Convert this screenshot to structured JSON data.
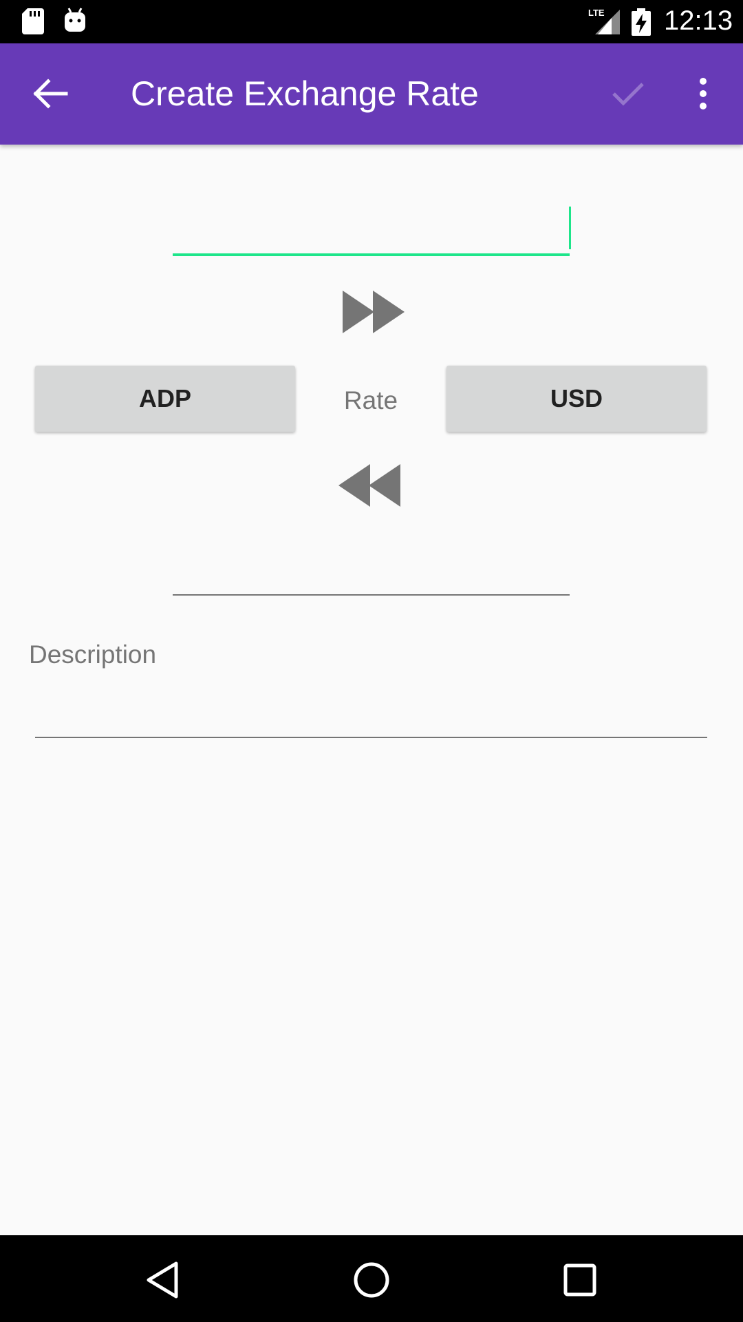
{
  "status_bar": {
    "time": "12:13",
    "icons": [
      "sd-card-icon",
      "android-icon",
      "lte-signal-icon",
      "battery-charging-icon"
    ]
  },
  "app_bar": {
    "title": "Create Exchange Rate",
    "icons": [
      "arrow-back-icon",
      "check-icon",
      "more-vert-icon"
    ]
  },
  "form": {
    "from_amount": "",
    "from_currency": "ADP",
    "rate_label": "Rate",
    "to_currency": "USD",
    "to_amount": "",
    "description_label": "Description",
    "description_value": ""
  },
  "colors": {
    "primary": "#673ab7",
    "accent": "#1de58a",
    "button": "#d6d7d7",
    "icon_gray": "#757575"
  },
  "nav_bar": {
    "icons": [
      "nav-back-icon",
      "nav-home-icon",
      "nav-recents-icon"
    ]
  }
}
